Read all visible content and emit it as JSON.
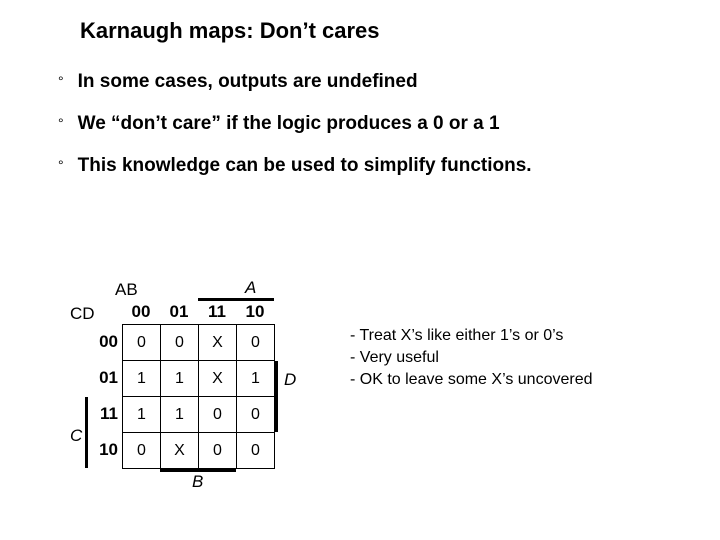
{
  "title": "Karnaugh maps: Don’t cares",
  "bullets": [
    "In some cases, outputs are undefined",
    "We “don’t care” if the logic produces a 0 or a 1",
    "This knowledge can be used to simplify functions."
  ],
  "kmap": {
    "label_AB": "AB",
    "label_CD": "CD",
    "label_A": "A",
    "label_B": "B",
    "label_C": "C",
    "label_D": "D",
    "col_headers": [
      "00",
      "01",
      "11",
      "10"
    ],
    "row_headers": [
      "00",
      "01",
      "11",
      "10"
    ],
    "cells": [
      [
        "0",
        "0",
        "X",
        "0"
      ],
      [
        "1",
        "1",
        "X",
        "1"
      ],
      [
        "1",
        "1",
        "0",
        "0"
      ],
      [
        "0",
        "X",
        "0",
        "0"
      ]
    ]
  },
  "notes": [
    "- Treat X’s like either 1’s or 0’s",
    "- Very useful",
    "- OK to leave some X’s uncovered"
  ],
  "chart_data": {
    "type": "table",
    "title": "4-variable Karnaugh map (AB vs CD) with don't-cares",
    "col_variable": "AB",
    "row_variable": "CD",
    "columns": [
      "00",
      "01",
      "11",
      "10"
    ],
    "rows": [
      "00",
      "01",
      "11",
      "10"
    ],
    "values": [
      [
        "0",
        "0",
        "X",
        "0"
      ],
      [
        "1",
        "1",
        "X",
        "1"
      ],
      [
        "1",
        "1",
        "0",
        "0"
      ],
      [
        "0",
        "X",
        "0",
        "0"
      ]
    ],
    "side_bars": {
      "A": {
        "covers_columns": [
          "11",
          "10"
        ]
      },
      "B": {
        "covers_columns": [
          "01",
          "11"
        ]
      },
      "C": {
        "covers_rows": [
          "11",
          "10"
        ]
      },
      "D": {
        "covers_rows": [
          "01",
          "11"
        ]
      }
    }
  }
}
